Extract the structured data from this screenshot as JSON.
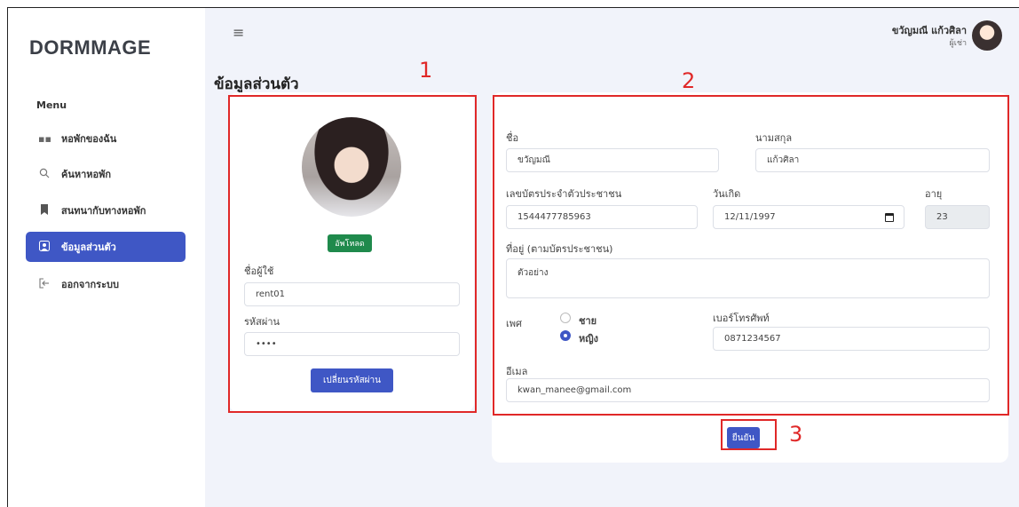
{
  "app": {
    "logo": "DORMMAGE"
  },
  "sidebar": {
    "menu_title": "Menu",
    "items": [
      {
        "label": "หอพักของฉัน",
        "icon": "grid-icon",
        "active": false
      },
      {
        "label": "ค้นหาหอพัก",
        "icon": "search-icon",
        "active": false
      },
      {
        "label": "สนทนากับทางหอพัก",
        "icon": "bookmark-icon",
        "active": false
      },
      {
        "label": "ข้อมูลส่วนตัว",
        "icon": "user-icon",
        "active": true
      },
      {
        "label": "ออกจากระบบ",
        "icon": "logout-icon",
        "active": false
      }
    ]
  },
  "header": {
    "user_name": "ขวัญมณี แก้วศิลา",
    "user_role": "ผู้เช่า"
  },
  "page": {
    "title": "ข้อมูลส่วนตัว"
  },
  "annotations": {
    "n1": "1",
    "n2": "2",
    "n3": "3"
  },
  "account": {
    "upload_label": "อัพโหลด",
    "username_label": "ชื่อผู้ใช้",
    "username_value": "rent01",
    "password_label": "รหัสผ่าน",
    "password_value": "••••",
    "change_password_label": "เปลี่ยนรหัสผ่าน"
  },
  "form": {
    "first_name_label": "ชื่อ",
    "first_name_value": "ขวัญมณี",
    "last_name_label": "นามสกุล",
    "last_name_value": "แก้วศิลา",
    "id_card_label": "เลขบัตรประจำตัวประชาชน",
    "id_card_value": "1544477785963",
    "birthdate_label": "วันเกิด",
    "birthdate_value": "12/11/1997",
    "age_label": "อายุ",
    "age_value": "23",
    "address_label": "ที่อยู่ (ตามบัตรประชาชน)",
    "address_value": "ตัวอย่าง",
    "gender_label": "เพศ",
    "gender_options": [
      {
        "label": "ชาย",
        "selected": false
      },
      {
        "label": "หญิง",
        "selected": true
      }
    ],
    "phone_label": "เบอร์โทรศัพท์",
    "phone_value": "0871234567",
    "email_label": "อีเมล",
    "email_value": "kwan_manee@gmail.com",
    "confirm_label": "ยืนยัน"
  },
  "colors": {
    "primary": "#3f57c5",
    "success": "#1f8a4c",
    "annotation": "#e02828",
    "background": "#f1f3fa"
  }
}
